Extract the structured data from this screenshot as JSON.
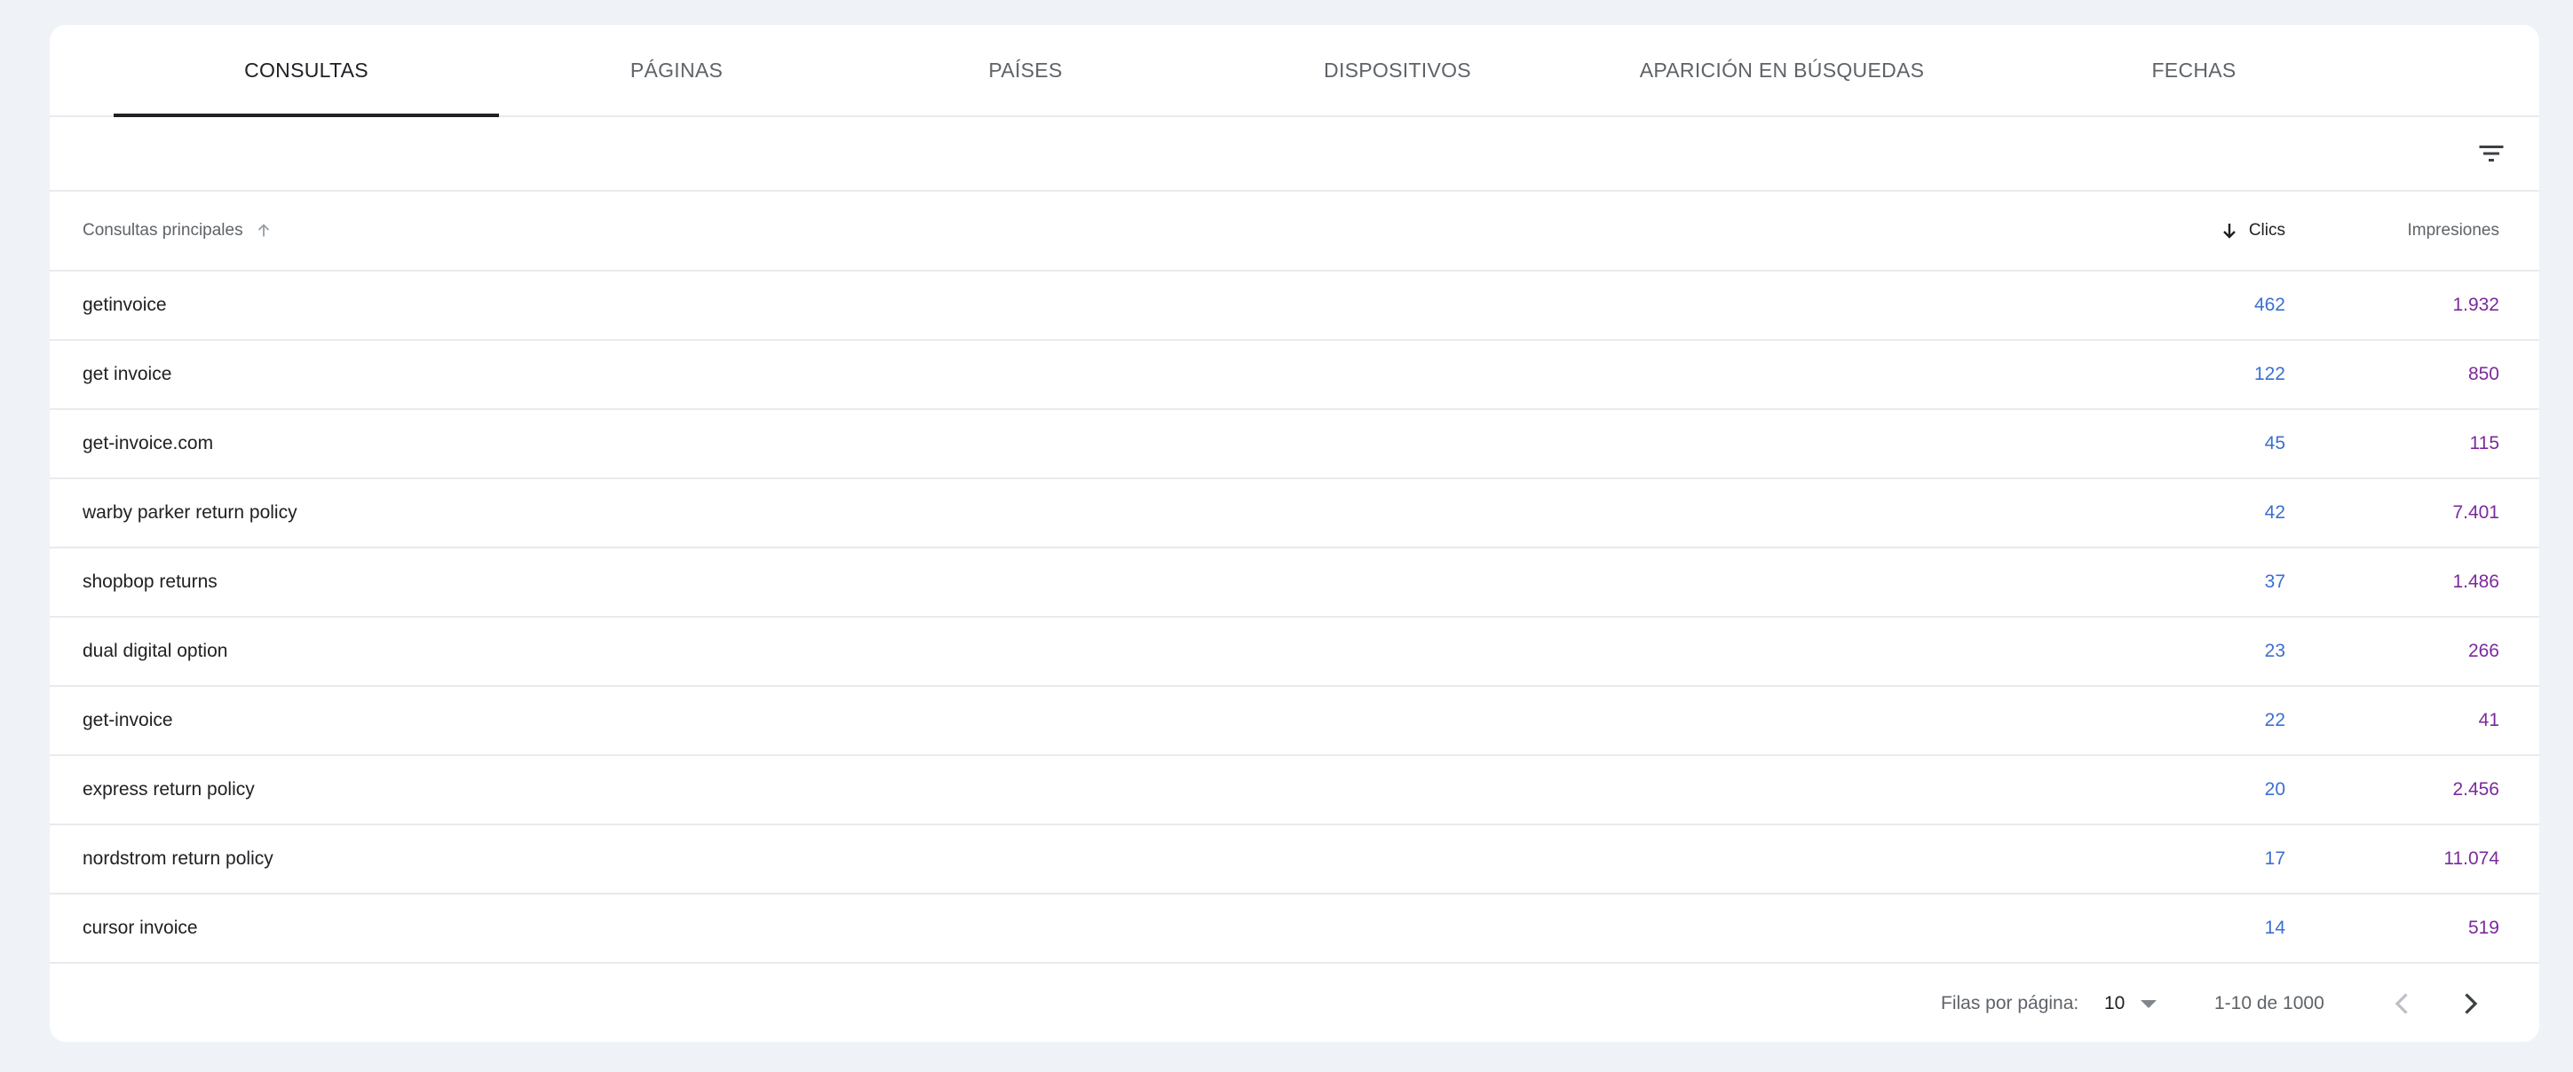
{
  "tabs": [
    {
      "label": "CONSULTAS",
      "active": true
    },
    {
      "label": "PÁGINAS",
      "active": false
    },
    {
      "label": "PAÍSES",
      "active": false
    },
    {
      "label": "DISPOSITIVOS",
      "active": false
    },
    {
      "label": "APARICIÓN EN BÚSQUEDAS",
      "active": false
    },
    {
      "label": "FECHAS",
      "active": false
    }
  ],
  "toolbar": {
    "filter_icon": "filter-list-icon"
  },
  "table": {
    "headers": {
      "query": "Consultas principales",
      "clicks": "Clics",
      "impressions": "Impresiones"
    },
    "sort": {
      "column": "clicks",
      "direction": "descending"
    },
    "rows": [
      {
        "query": "getinvoice",
        "clicks": "462",
        "impressions": "1.932"
      },
      {
        "query": "get invoice",
        "clicks": "122",
        "impressions": "850"
      },
      {
        "query": "get-invoice.com",
        "clicks": "45",
        "impressions": "115"
      },
      {
        "query": "warby parker return policy",
        "clicks": "42",
        "impressions": "7.401"
      },
      {
        "query": "shopbop returns",
        "clicks": "37",
        "impressions": "1.486"
      },
      {
        "query": "dual digital option",
        "clicks": "23",
        "impressions": "266"
      },
      {
        "query": "get-invoice",
        "clicks": "22",
        "impressions": "41"
      },
      {
        "query": "express return policy",
        "clicks": "20",
        "impressions": "2.456"
      },
      {
        "query": "nordstrom return policy",
        "clicks": "17",
        "impressions": "11.074"
      },
      {
        "query": "cursor invoice",
        "clicks": "14",
        "impressions": "519"
      }
    ]
  },
  "pagination": {
    "rows_per_page_label": "Filas por página:",
    "rows_per_page_value": "10",
    "range": "1-10 de 1000"
  },
  "colors": {
    "clicks": "#3c6fd1",
    "impressions": "#7b2a9c",
    "background": "#eff2f6"
  }
}
